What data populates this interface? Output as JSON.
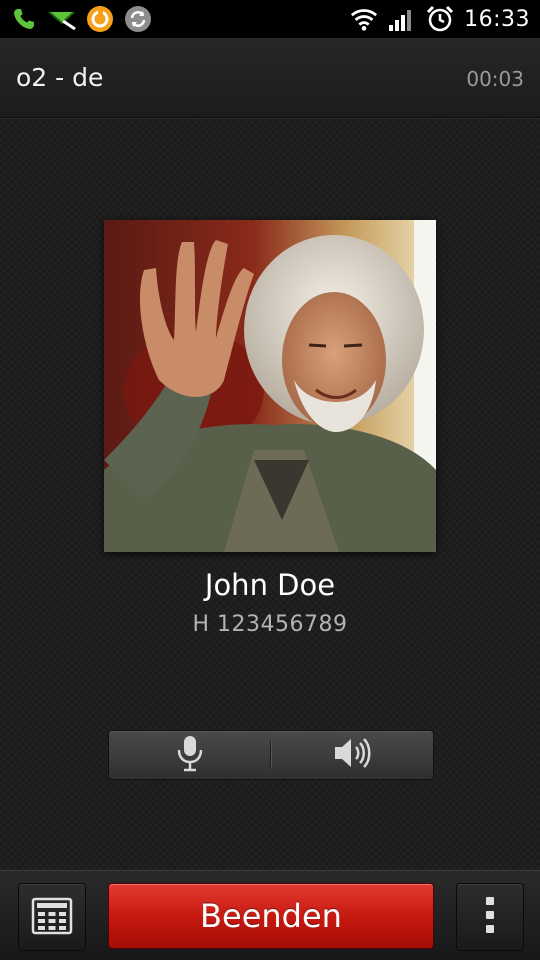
{
  "status_bar": {
    "time": "16:33",
    "icons_left": [
      "phone-call-icon",
      "missed-message-icon",
      "orange-app-icon",
      "sync-icon"
    ],
    "icons_right": [
      "wifi-icon",
      "signal-icon",
      "alarm-icon"
    ]
  },
  "call": {
    "carrier": "o2 - de",
    "duration": "00:03"
  },
  "contact": {
    "name": "John Doe",
    "number": "H 123456789"
  },
  "controls": {
    "mute_icon": "microphone-icon",
    "speaker_icon": "speaker-icon"
  },
  "bottom_bar": {
    "end_call_label": "Beenden",
    "dialpad_icon": "dialpad-icon",
    "menu_icon": "more-vertical-icon"
  },
  "colors": {
    "end_call_red": "#c4170f",
    "status_green": "#5cc43b",
    "background": "#1b1b1b"
  }
}
